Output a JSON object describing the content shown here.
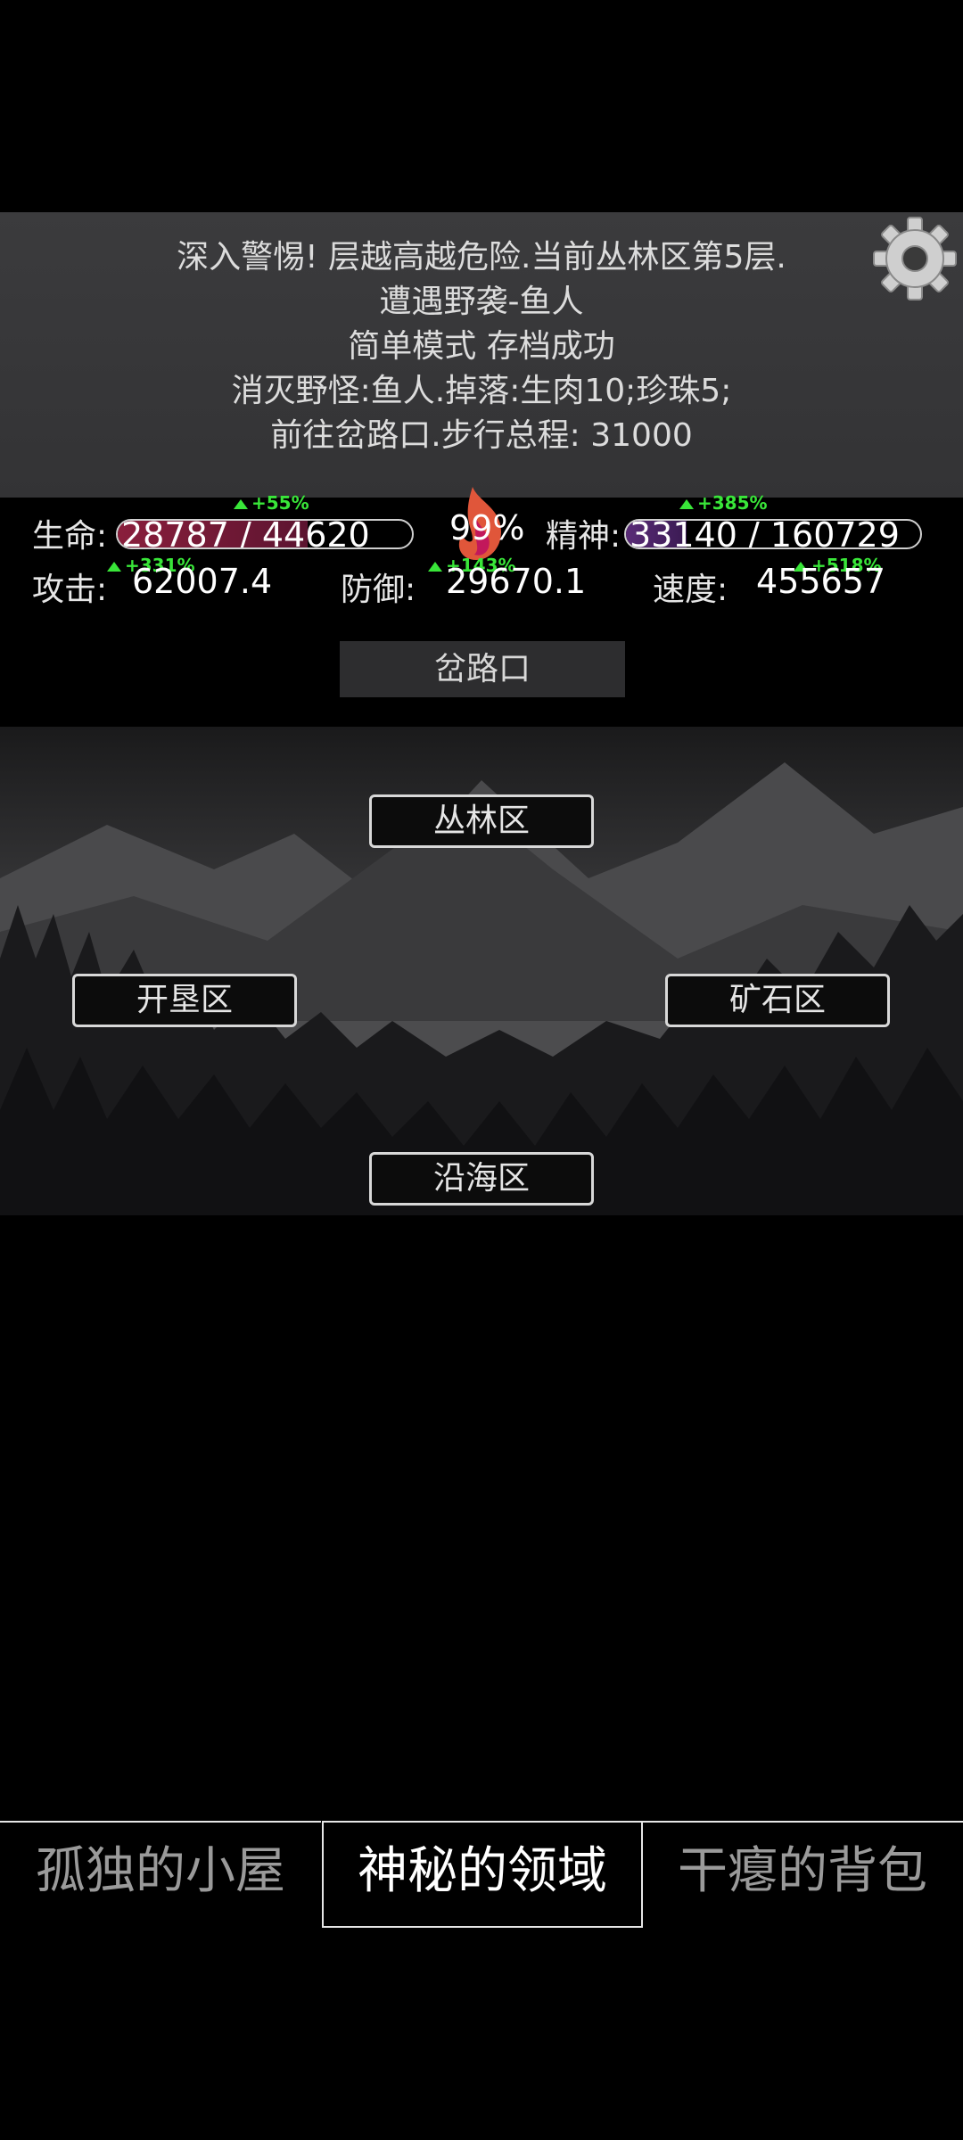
{
  "messages": [
    "深入警惕! 层越高越危险.当前丛林区第5层.",
    "遭遇野袭-鱼人",
    "简单模式 存档成功",
    "消灭野怪:鱼人.掉落:生肉10;珍珠5;",
    "前往岔路口.步行总程: 31000"
  ],
  "stats": {
    "life_label": "生命:",
    "life_value": "28787 / 44620",
    "life_fraction": 0.645,
    "life_bonus": "+55%",
    "hunger": "99%",
    "spirit_label": "精神:",
    "spirit_value": "33140 / 160729",
    "spirit_fraction": 0.206,
    "spirit_bonus": "+385%",
    "attack_label": "攻击:",
    "attack_value": "62007.4",
    "attack_bonus": "+331%",
    "defense_label": "防御:",
    "defense_value": "29670.1",
    "defense_bonus": "+143%",
    "speed_label": "速度:",
    "speed_value": "455657",
    "speed_bonus": "+518%"
  },
  "location": "岔路口",
  "zones": {
    "north": "丛林区",
    "west": "开垦区",
    "east": "矿石区",
    "south": "沿海区"
  },
  "tabs": [
    "孤独的小屋",
    "神秘的领域",
    "干瘪的背包"
  ],
  "colors": {
    "life_bar": "#8a1f3c",
    "spirit_bar": "#5a2c78",
    "bonus": "#39e639",
    "flame": "#e0563a"
  }
}
